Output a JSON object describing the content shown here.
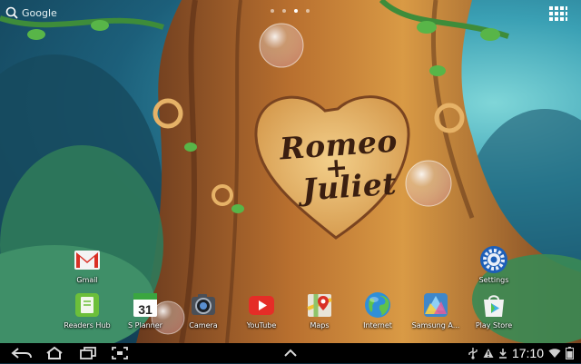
{
  "top_bar": {
    "search_label": "Google",
    "search_icon": "search-icon",
    "apps_icon": "app-drawer-icon"
  },
  "wallpaper": {
    "carving_line1": "Romeo",
    "carving_line2": "+",
    "carving_line3": "Juliet"
  },
  "home_icons": [
    {
      "id": "gmail",
      "label": "Gmail",
      "icon": "gmail-icon"
    },
    {
      "id": "settings",
      "label": "Settings",
      "icon": "settings-gear-icon"
    }
  ],
  "dock": [
    {
      "id": "readers-hub",
      "label": "Readers Hub",
      "icon": "readers-hub-icon"
    },
    {
      "id": "s-planner",
      "label": "S Planner",
      "icon": "calendar-icon",
      "day": "31"
    },
    {
      "id": "camera",
      "label": "Camera",
      "icon": "camera-icon"
    },
    {
      "id": "youtube",
      "label": "YouTube",
      "icon": "youtube-icon"
    },
    {
      "id": "maps",
      "label": "Maps",
      "icon": "maps-icon"
    },
    {
      "id": "internet",
      "label": "Internet",
      "icon": "globe-icon"
    },
    {
      "id": "samsung-apps",
      "label": "Samsung A...",
      "icon": "samsung-apps-icon"
    },
    {
      "id": "play-store",
      "label": "Play Store",
      "icon": "play-store-icon"
    }
  ],
  "nav_bar": {
    "back_icon": "back-icon",
    "home_icon": "home-icon",
    "recents_icon": "recent-apps-icon",
    "screenshot_icon": "screenshot-icon",
    "up_icon": "chevron-up-icon"
  },
  "status": {
    "time": "17:10",
    "icons": [
      "usb-icon",
      "warning-icon",
      "download-icon",
      "wifi-icon",
      "battery-icon"
    ]
  },
  "colors": {
    "navbar": "#000000",
    "gmail_red": "#d93025",
    "youtube_red": "#e52d27",
    "calendar_green": "#3aa640"
  }
}
